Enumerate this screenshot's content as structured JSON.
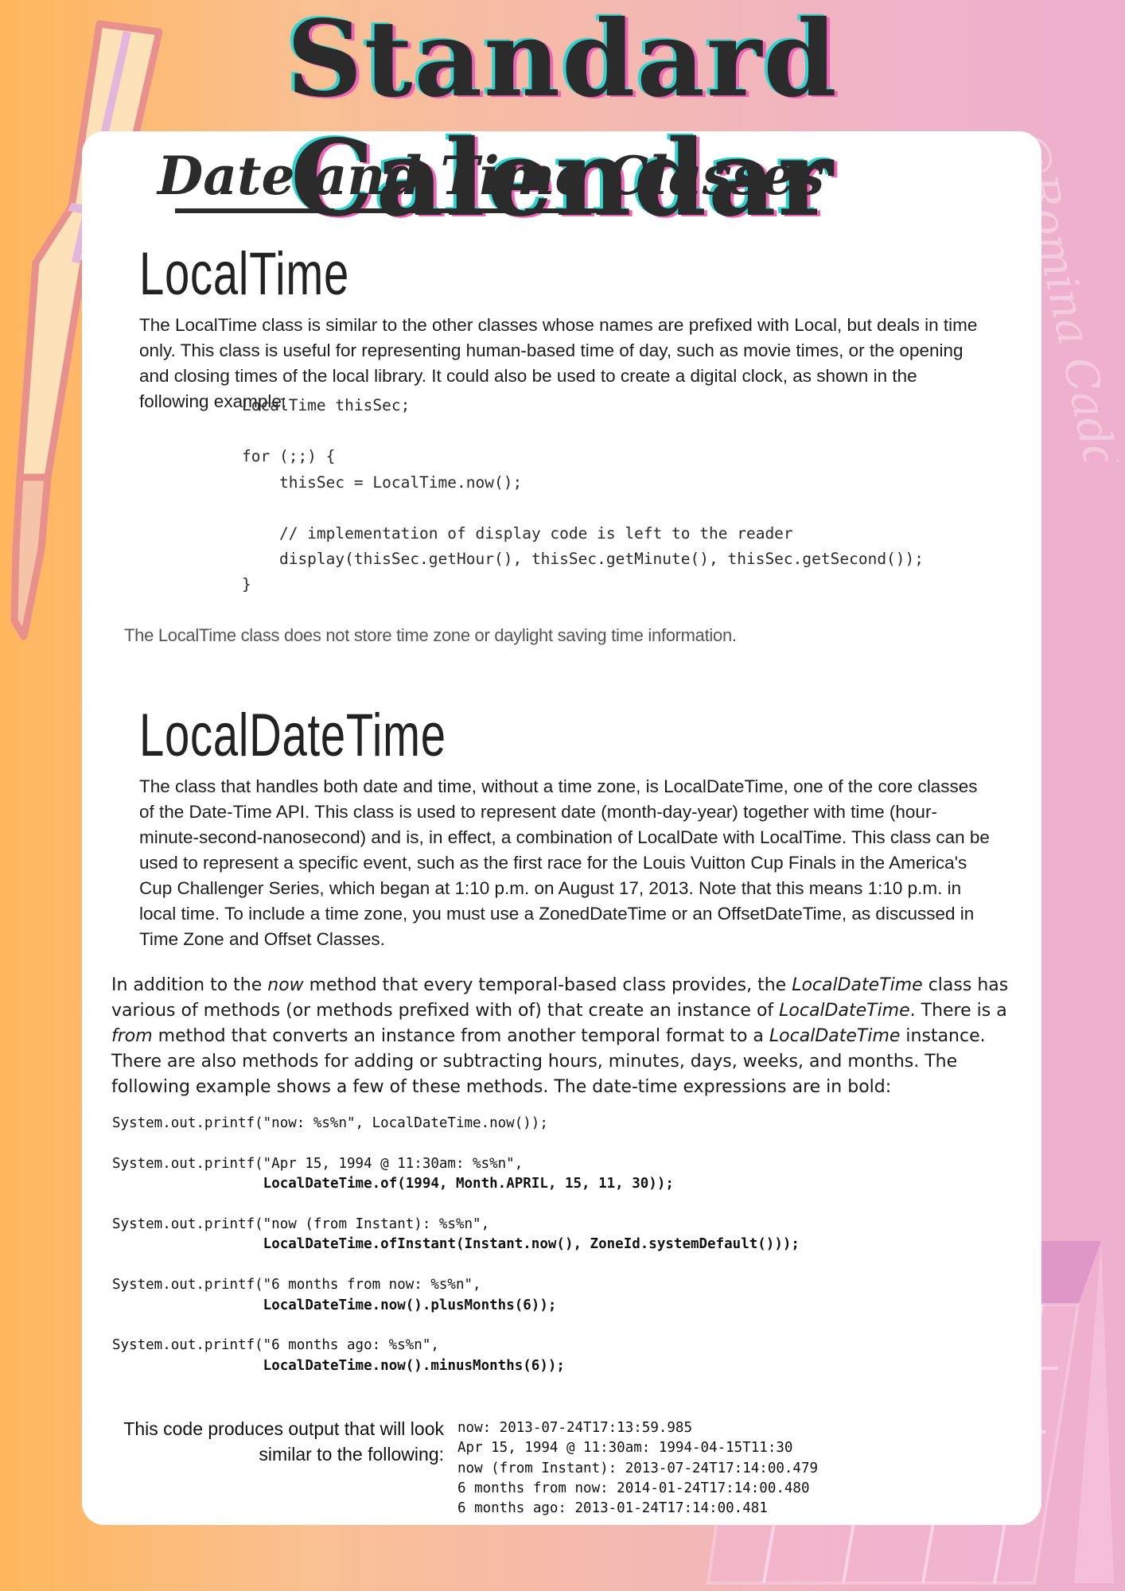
{
  "header": {
    "title": "Standard Calendar",
    "subtitle": "Date and Time Classes"
  },
  "watermark": "@Romina Caddolo",
  "sections": {
    "localtime": {
      "heading": "LocalTime",
      "paragraph": [
        "The LocalTime class is similar to the other classes whose names are prefixed with Local, but deals in time",
        "only. This class is useful for representing human-based time of day, such as movie times, or the opening",
        "and closing times of the local library. It could also be used to create a digital clock, as shown in the",
        "following example:"
      ],
      "code": [
        "LocalTime thisSec;",
        "",
        "for (;;) {",
        "    thisSec = LocalTime.now();",
        "",
        "    // implementation of display code is left to the reader",
        "    display(thisSec.getHour(), thisSec.getMinute(), thisSec.getSecond());",
        "}"
      ],
      "note": "The LocalTime class does not store time zone or daylight saving time information."
    },
    "localdatetime": {
      "heading": "LocalDateTime",
      "paragraph": [
        "The class that handles both date and time, without a time zone, is LocalDateTime, one of the core classes",
        "of the Date-Time API. This class is used to represent date (month-day-year) together with time (hour-",
        "minute-second-nanosecond) and is, in effect, a combination of LocalDate with LocalTime. This class can be",
        "used to represent a specific event, such as the first race for the Louis Vuitton Cup Finals in the America's",
        "Cup Challenger Series, which began at 1:10 p.m. on August 17, 2013. Note that this means 1:10 p.m. in",
        "local time. To include a time zone, you must use a ZonedDateTime or an OffsetDateTime, as discussed in",
        "Time Zone and Offset Classes."
      ],
      "methods_paragraph": [
        [
          "In addition to the ",
          "now",
          " method that every temporal-based class provides, the ",
          "LocalDateTime",
          " class has"
        ],
        [
          "various of methods (or methods prefixed with of) that create an instance of ",
          "LocalDateTime",
          ". There is a"
        ],
        [
          "",
          "from",
          " method that converts an instance from another temporal format to a ",
          "LocalDateTime",
          " instance."
        ],
        [
          "There are also methods for adding or subtracting hours, minutes, days, weeks, and months. The"
        ],
        [
          "following example shows a few of these methods. The date-time expressions are in bold:"
        ]
      ],
      "code": [
        {
          "plain": "System.out.printf(\"now: %s%n\", LocalDateTime.now());",
          "bold": ""
        },
        {
          "plain": "",
          "bold": ""
        },
        {
          "plain": "System.out.printf(\"Apr 15, 1994 @ 11:30am: %s%n\",",
          "bold": ""
        },
        {
          "plain": "                  ",
          "bold": "LocalDateTime.of(1994, Month.APRIL, 15, 11, 30));"
        },
        {
          "plain": "",
          "bold": ""
        },
        {
          "plain": "System.out.printf(\"now (from Instant): %s%n\",",
          "bold": ""
        },
        {
          "plain": "                  ",
          "bold": "LocalDateTime.ofInstant(Instant.now(), ZoneId.systemDefault()));"
        },
        {
          "plain": "",
          "bold": ""
        },
        {
          "plain": "System.out.printf(\"6 months from now: %s%n\",",
          "bold": ""
        },
        {
          "plain": "                  ",
          "bold": "LocalDateTime.now().plusMonths(6));"
        },
        {
          "plain": "",
          "bold": ""
        },
        {
          "plain": "System.out.printf(\"6 months ago: %s%n\",",
          "bold": ""
        },
        {
          "plain": "                  ",
          "bold": "LocalDateTime.now().minusMonths(6));"
        }
      ],
      "output_intro": [
        "This code produces output that will look",
        "similar to the following:"
      ],
      "output": [
        "now: 2013-07-24T17:13:59.985",
        "Apr 15, 1994 @ 11:30am: 1994-04-15T11:30",
        "now (from Instant): 2013-07-24T17:14:00.479",
        "6 months from now: 2014-01-24T17:14:00.480",
        "6 months ago: 2013-01-24T17:14:00.481"
      ]
    }
  },
  "colors": {
    "title_text": "#2b2b2b",
    "title_shadow_cyan": "#2fd3cf",
    "title_shadow_pink": "#f064b6",
    "pen_body": "#fde1b8",
    "pen_outline": "#e7908c",
    "calendar_outline": "#fbd3e6"
  }
}
